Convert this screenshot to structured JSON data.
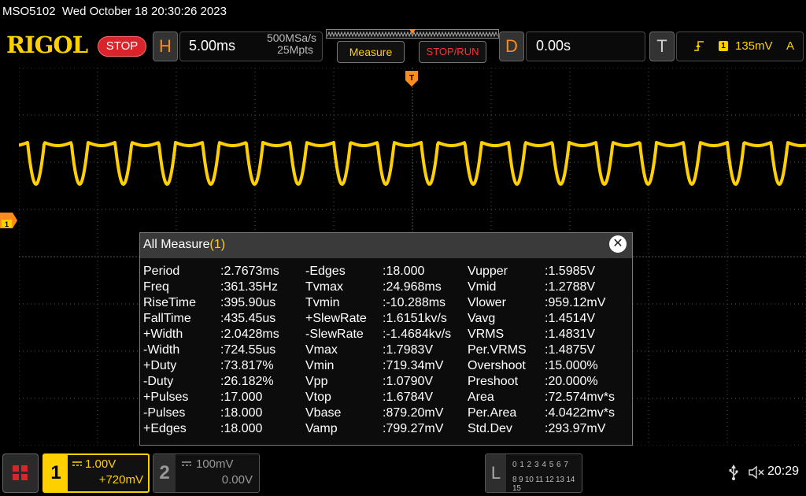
{
  "status_line": {
    "model": "MSO5102",
    "datetime": "Wed October 18 20:30:26 2023"
  },
  "brand": {
    "logo": "RIGOL",
    "run_state": "STOP"
  },
  "horizontal": {
    "letter": "H",
    "timebase": "5.00ms",
    "sample_rate": "500MSa/s",
    "memory_depth": "25Mpts"
  },
  "toolbar": {
    "measure_label": "Measure",
    "stoprun_label": "STOP/RUN"
  },
  "delay": {
    "letter": "D",
    "value": "0.00s"
  },
  "trigger": {
    "letter": "T",
    "source": "1",
    "level": "135mV",
    "mode": "A"
  },
  "measure_panel": {
    "title": "All Measure",
    "channel": "(1)",
    "columns": [
      [
        {
          "name": "Period",
          "value": ":2.7673ms"
        },
        {
          "name": "Freq",
          "value": ":361.35Hz"
        },
        {
          "name": "RiseTime",
          "value": ":395.90us"
        },
        {
          "name": "FallTime",
          "value": ":435.45us"
        },
        {
          "name": "+Width",
          "value": ":2.0428ms"
        },
        {
          "name": "-Width",
          "value": ":724.55us"
        },
        {
          "name": "+Duty",
          "value": ":73.817%"
        },
        {
          "name": "-Duty",
          "value": ":26.182%"
        },
        {
          "name": "+Pulses",
          "value": ":17.000"
        },
        {
          "name": "-Pulses",
          "value": ":18.000"
        },
        {
          "name": "+Edges",
          "value": ":18.000"
        }
      ],
      [
        {
          "name": "-Edges",
          "value": ":18.000"
        },
        {
          "name": "Tvmax",
          "value": ":24.968ms"
        },
        {
          "name": "Tvmin",
          "value": ":-10.288ms"
        },
        {
          "name": "+SlewRate",
          "value": ":1.6151kv/s"
        },
        {
          "name": "-SlewRate",
          "value": ":-1.4684kv/s"
        },
        {
          "name": "Vmax",
          "value": ":1.7983V"
        },
        {
          "name": "Vmin",
          "value": ":719.34mV"
        },
        {
          "name": "Vpp",
          "value": ":1.0790V"
        },
        {
          "name": "Vtop",
          "value": ":1.6784V"
        },
        {
          "name": "Vbase",
          "value": ":879.20mV"
        },
        {
          "name": "Vamp",
          "value": ":799.27mV"
        }
      ],
      [
        {
          "name": "Vupper",
          "value": ":1.5985V"
        },
        {
          "name": "Vmid",
          "value": ":1.2788V"
        },
        {
          "name": "Vlower",
          "value": ":959.12mV"
        },
        {
          "name": "Vavg",
          "value": ":1.4514V"
        },
        {
          "name": "VRMS",
          "value": ":1.4831V"
        },
        {
          "name": "Per.VRMS",
          "value": ":1.4875V"
        },
        {
          "name": "Overshoot",
          "value": ":15.000%"
        },
        {
          "name": "Preshoot",
          "value": ":20.000%"
        },
        {
          "name": "Area",
          "value": ":72.574mv*s"
        },
        {
          "name": "Per.Area",
          "value": ":4.0422mv*s"
        },
        {
          "name": "Std.Dev",
          "value": ":293.97mV"
        }
      ]
    ]
  },
  "channels": [
    {
      "number": "1",
      "scale": "1.00V",
      "offset": "+720mV",
      "active": true
    },
    {
      "number": "2",
      "scale": "100mV",
      "offset": "0.00V",
      "active": false
    }
  ],
  "logic_analyzer": {
    "letter": "L",
    "row1": "0 1 2 3   4 5 6 7",
    "row2": "8 9 10 11 12 13 14 15"
  },
  "system": {
    "clock": "20:29"
  },
  "colors": {
    "ch1": "#ffd000",
    "accent": "#ff8c1a",
    "stop": "#d8242a",
    "grid": "#555555"
  },
  "icons": [
    "usb-icon",
    "speaker-muted-icon",
    "trigger-rising-edge-icon",
    "close-icon",
    "home-grid-icon",
    "dc-coupling-icon"
  ],
  "waveform": {
    "channel": "1",
    "cycles_on_screen": 18
  }
}
